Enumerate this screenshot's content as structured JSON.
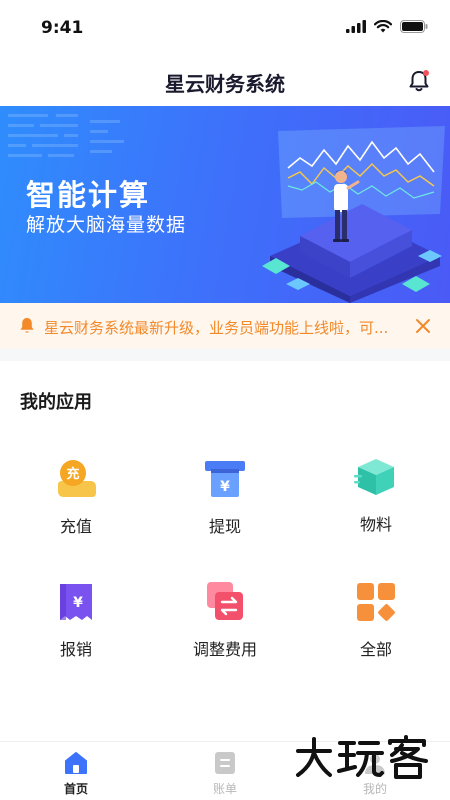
{
  "status_bar": {
    "time": "9:41"
  },
  "header": {
    "title": "星云财务系统"
  },
  "banner": {
    "title": "智能计算",
    "subtitle": "解放大脑海量数据"
  },
  "notice": {
    "text": "星云财务系统最新升级，业务员端功能上线啦，可..."
  },
  "apps_section": {
    "title": "我的应用",
    "items": [
      {
        "label": "充值",
        "icon": "recharge-icon",
        "badge": "充"
      },
      {
        "label": "提现",
        "icon": "withdraw-icon",
        "badge": "¥"
      },
      {
        "label": "物料",
        "icon": "materials-box-icon"
      },
      {
        "label": "报销",
        "icon": "reimburse-receipt-icon",
        "badge": "¥"
      },
      {
        "label": "调整费用",
        "icon": "adjust-fee-icon"
      },
      {
        "label": "全部",
        "icon": "all-apps-icon"
      }
    ]
  },
  "tabbar": {
    "tabs": [
      {
        "label": "首页",
        "icon": "home-icon",
        "active": true
      },
      {
        "label": "账单",
        "icon": "bill-icon",
        "active": false
      },
      {
        "label": "我的",
        "icon": "profile-icon",
        "active": false
      }
    ]
  },
  "colors": {
    "primary": "#3d72fb",
    "notice_text": "#f28a2a",
    "notice_bg": "#fff6ee",
    "recharge": "#f5b021",
    "withdraw": "#4a7cf6",
    "materials": "#3fd2b8",
    "reimburse": "#7a52f0",
    "adjust": "#f3506c",
    "all": "#f7903a"
  }
}
